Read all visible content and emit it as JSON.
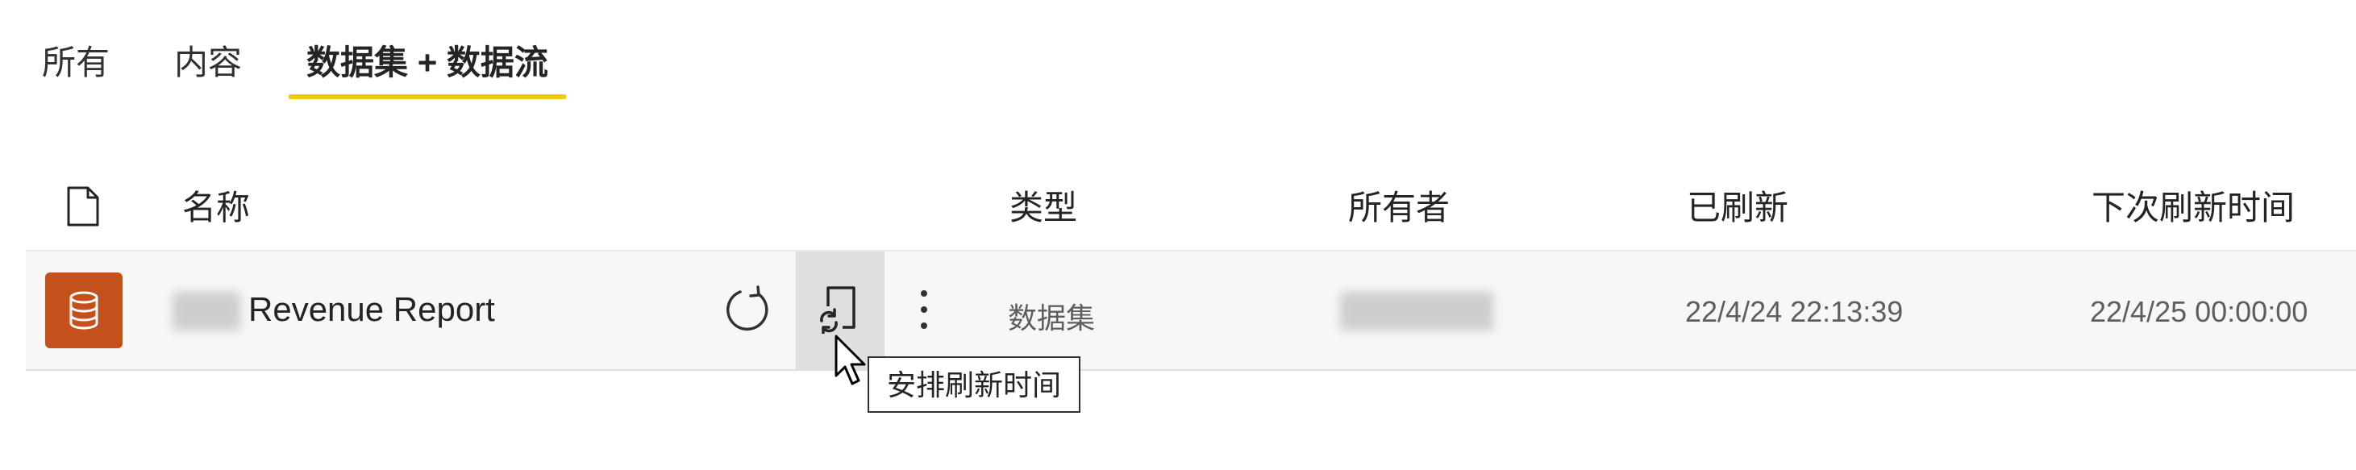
{
  "tabs": [
    {
      "label": "所有",
      "active": false
    },
    {
      "label": "内容",
      "active": false
    },
    {
      "label": "数据集 + 数据流",
      "active": true
    }
  ],
  "table": {
    "header_icon": "document-icon",
    "columns": [
      "名称",
      "类型",
      "所有者",
      "已刷新",
      "下次刷新时间"
    ],
    "rows": [
      {
        "icon": "database-icon",
        "icon_color": "#c4501c",
        "name": "Revenue Report",
        "type": "数据集",
        "owner": "",
        "refreshed": "22/4/24 22:13:39",
        "next_refresh": "22/4/25 00:00:00"
      }
    ]
  },
  "actions": {
    "refresh_icon": "refresh-icon",
    "schedule_icon": "schedule-refresh-icon",
    "more_icon": "more-options-icon"
  },
  "tooltip": "安排刷新时间",
  "colors": {
    "accent_underline": "#f2c811",
    "row_background": "#f8f7f6",
    "hover_background": "#e1dfdd"
  }
}
